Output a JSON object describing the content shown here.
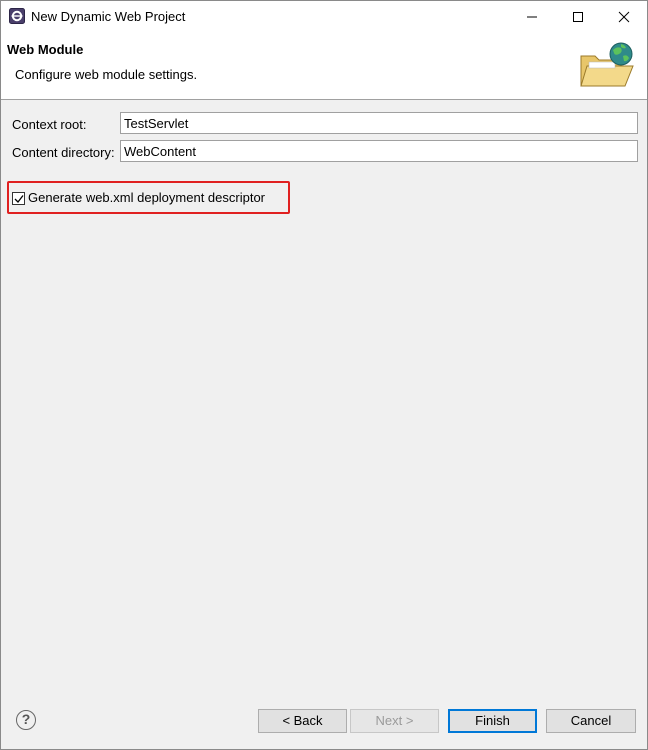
{
  "window": {
    "title": "New Dynamic Web Project",
    "controls": {
      "minimize_icon": "minimize-icon",
      "maximize_icon": "maximize-icon",
      "close_icon": "close-icon"
    }
  },
  "header": {
    "title": "Web Module",
    "description": "Configure web module settings.",
    "icon": "web-folder-globe-icon"
  },
  "form": {
    "context_root": {
      "label": "Context root:",
      "value": "TestServlet"
    },
    "content_directory": {
      "label": "Content directory:",
      "value": "WebContent"
    },
    "generate_descriptor": {
      "label": "Generate web.xml deployment descriptor",
      "checked": true
    }
  },
  "footer": {
    "help": "?",
    "back": "< Back",
    "next": "Next >",
    "finish": "Finish",
    "cancel": "Cancel"
  },
  "colors": {
    "highlight": "#e02020",
    "default_button_border": "#0078d7"
  }
}
